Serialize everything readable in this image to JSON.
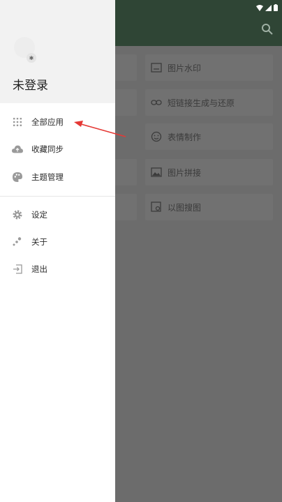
{
  "background": {
    "tiles": [
      {
        "label": "图片水印",
        "icon": "image-frame-icon"
      },
      {
        "label": "短链接生成与还原",
        "icon": "link-icon"
      },
      {
        "label": "表情制作",
        "icon": "smiley-icon"
      },
      {
        "label": "图片拼接",
        "icon": "image-icon"
      },
      {
        "label": "以图搜图",
        "icon": "image-search-icon"
      }
    ]
  },
  "drawer": {
    "login_text": "未登录",
    "menu": [
      {
        "label": "全部应用",
        "icon": "grid-icon"
      },
      {
        "label": "收藏同步",
        "icon": "cloud-upload-icon"
      },
      {
        "label": "主题管理",
        "icon": "palette-icon"
      }
    ],
    "menu2": [
      {
        "label": "设定",
        "icon": "gear-icon"
      },
      {
        "label": "关于",
        "icon": "dots-icon"
      },
      {
        "label": "退出",
        "icon": "exit-icon"
      }
    ]
  },
  "colors": {
    "toolbar": "#2f4535",
    "scrim": "#6c6c6c",
    "drawer_header": "#f2f2f2",
    "annotation_arrow": "#e53935"
  }
}
